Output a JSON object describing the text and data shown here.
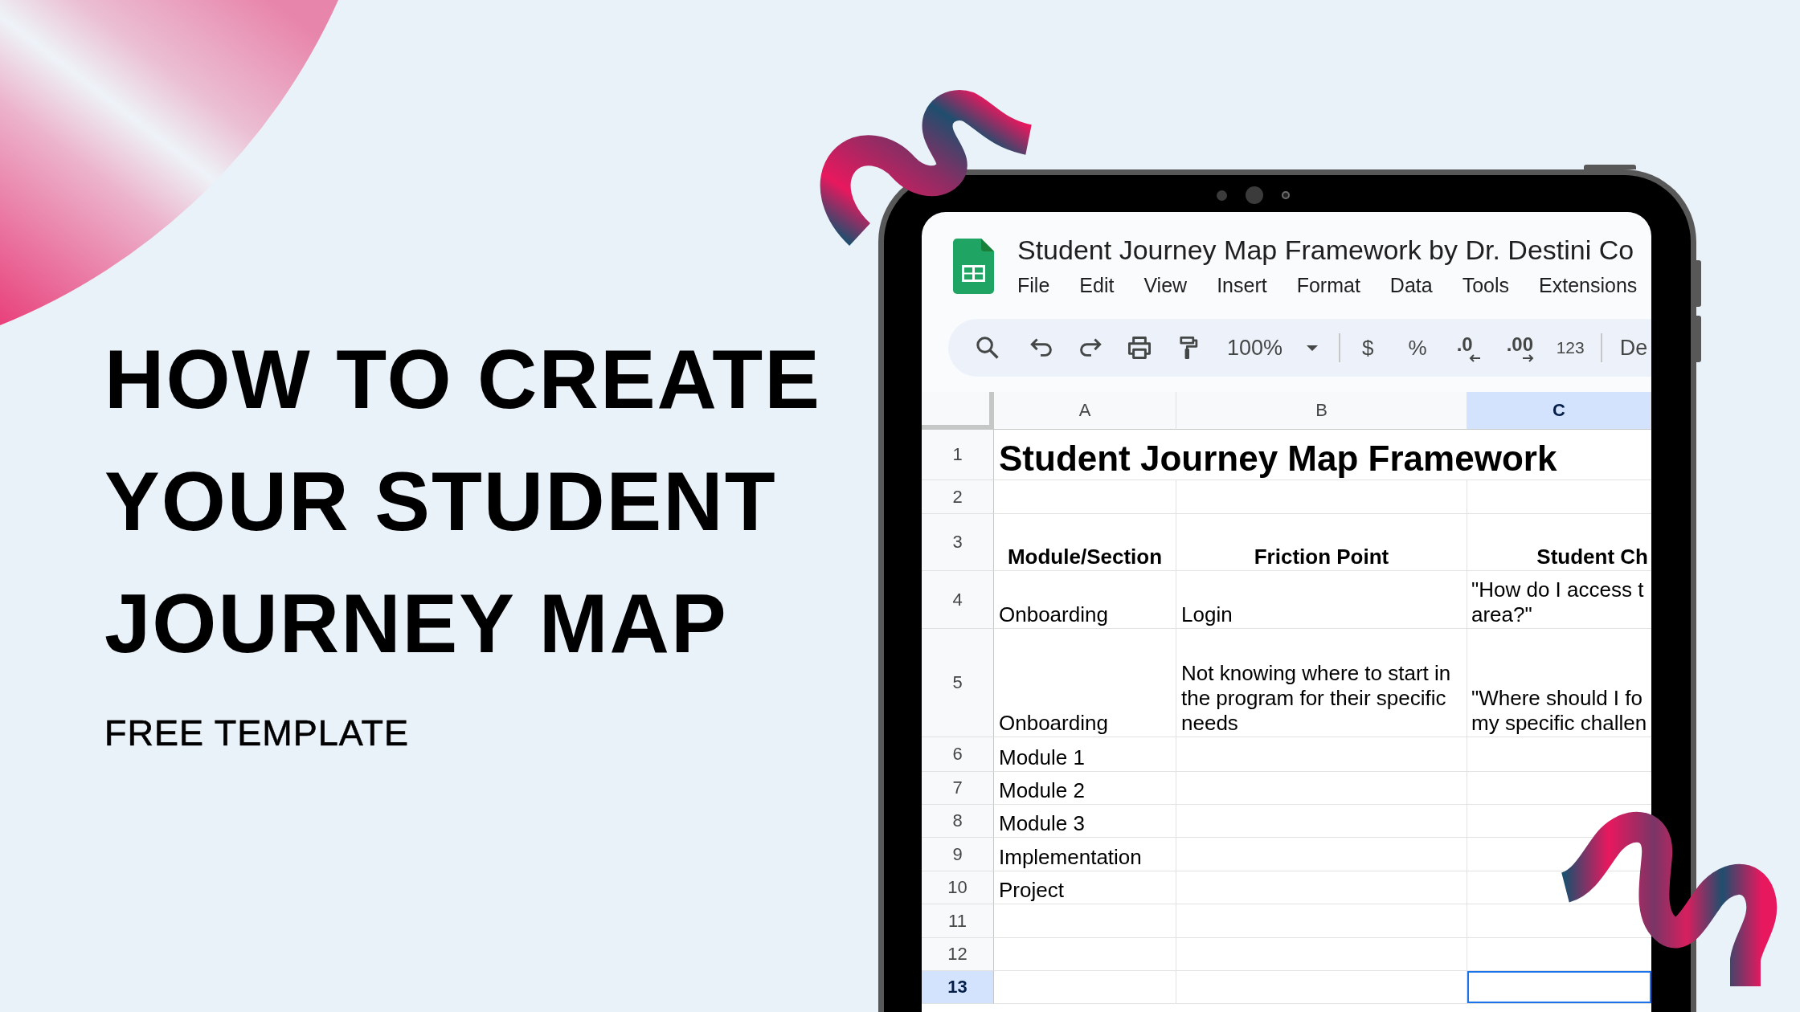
{
  "headline": {
    "lines": [
      "HOW TO CREATE",
      "YOUR STUDENT",
      "JOURNEY MAP"
    ],
    "subtitle": "FREE TEMPLATE"
  },
  "spreadsheet": {
    "title": "Student Journey Map Framework by Dr. Destini Co",
    "menu": [
      "File",
      "Edit",
      "View",
      "Insert",
      "Format",
      "Data",
      "Tools",
      "Extensions"
    ],
    "toolbar": {
      "zoom": "100%",
      "format_buttons": [
        {
          "kind": "symbol",
          "label": "$"
        },
        {
          "kind": "symbol",
          "label": "%"
        },
        {
          "kind": "decrease",
          "label": ".0"
        },
        {
          "kind": "increase",
          "label": ".00"
        },
        {
          "kind": "number",
          "label": "123"
        }
      ],
      "font": "De"
    },
    "columns": [
      {
        "label": "A",
        "selected": false
      },
      {
        "label": "B",
        "selected": false
      },
      {
        "label": "C",
        "selected": true
      }
    ],
    "rows": [
      {
        "number": "1",
        "selected": false,
        "kind": "title",
        "text": "Student Journey Map Framework"
      },
      {
        "number": "2",
        "selected": false,
        "kind": "plain"
      },
      {
        "number": "3",
        "selected": false,
        "kind": "header",
        "cells": [
          "Module/Section",
          "Friction Point",
          "Student Ch"
        ]
      },
      {
        "number": "4",
        "selected": false,
        "kind": "plain",
        "cells": [
          "Onboarding",
          "Login",
          "\"How do I access t\narea?\""
        ]
      },
      {
        "number": "5",
        "selected": false,
        "kind": "plain",
        "cells": [
          "Onboarding",
          "Not knowing where to start in the program for their specific needs",
          "\"Where should I fo\nmy specific challen"
        ]
      },
      {
        "number": "6",
        "selected": false,
        "kind": "plain",
        "cells": [
          "Module 1"
        ]
      },
      {
        "number": "7",
        "selected": false,
        "kind": "plain",
        "cells": [
          "Module 2"
        ]
      },
      {
        "number": "8",
        "selected": false,
        "kind": "plain",
        "cells": [
          "Module 3"
        ]
      },
      {
        "number": "9",
        "selected": false,
        "kind": "plain",
        "cells": [
          "Implementation"
        ]
      },
      {
        "number": "10",
        "selected": false,
        "kind": "plain",
        "cells": [
          "Project"
        ]
      },
      {
        "number": "11",
        "selected": false,
        "kind": "plain"
      },
      {
        "number": "12",
        "selected": false,
        "kind": "plain"
      },
      {
        "number": "13",
        "selected": true,
        "kind": "plain"
      }
    ]
  }
}
